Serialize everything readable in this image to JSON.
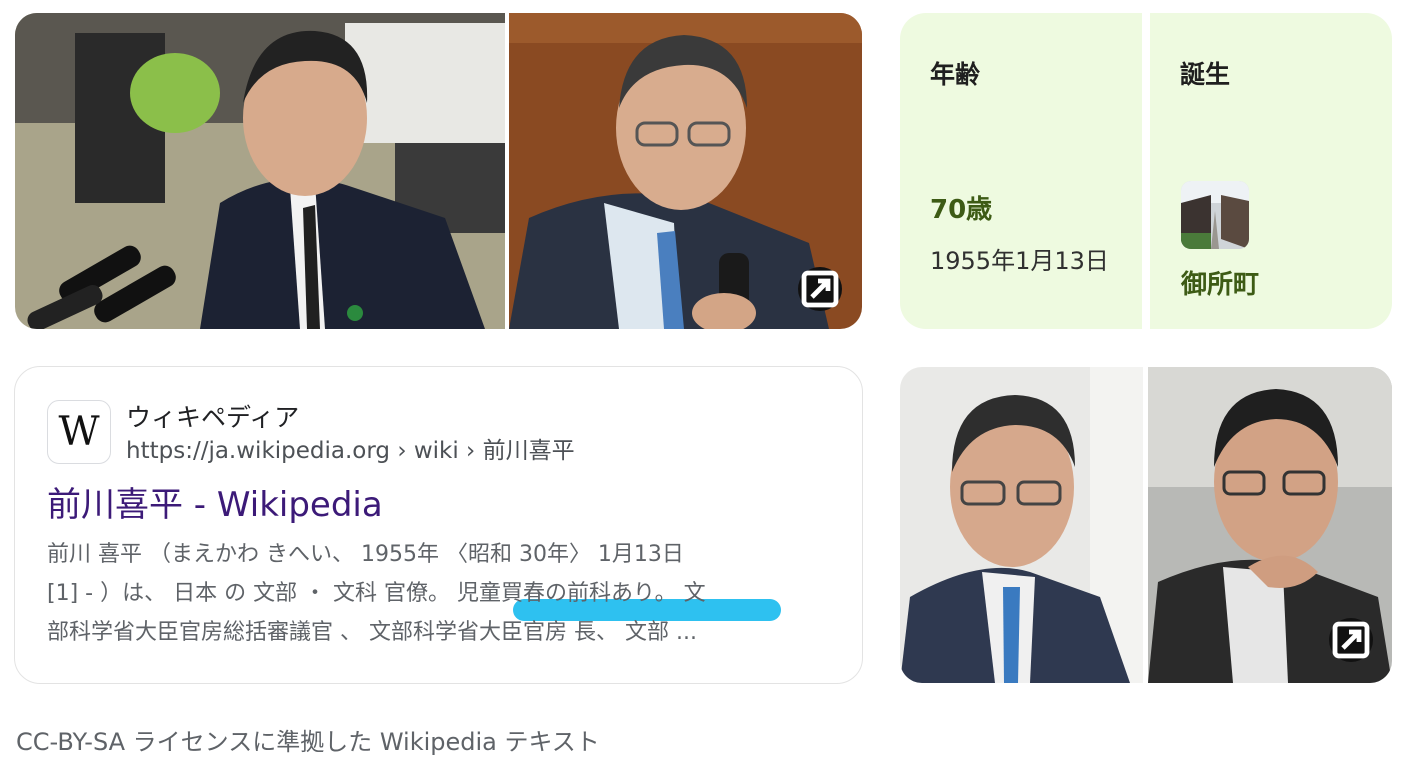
{
  "facts": {
    "age": {
      "label": "年齢",
      "value": "70歳",
      "date": "1955年1月13日"
    },
    "birth": {
      "label": "誕生",
      "place": "御所町"
    }
  },
  "result": {
    "favicon_letter": "W",
    "site_name": "ウィキペディア",
    "url": "https://ja.wikipedia.org › wiki › 前川喜平",
    "title": "前川喜平 - Wikipedia",
    "snippet_lines": [
      "前川 喜平 （まえかわ きへい、 1955年 〈昭和 30年〉 1月13日",
      "[1] - ）は、 日本 の 文部 ・ 文科 官僚。 児童買春の前科あり。 文",
      "部科学省大臣官房総括審議官 、 文部科学省大臣官房 長、 文部 ..."
    ]
  },
  "footer_text": "CC-BY-SA ライセンスに準拠した Wikipedia テキスト",
  "icons": {
    "expand": "expand-image-icon"
  },
  "colors": {
    "fact_bg": "#eefae0",
    "fact_value": "#3d5b15",
    "title_link": "#3c1a78",
    "highlight": "#2ec1f0"
  }
}
